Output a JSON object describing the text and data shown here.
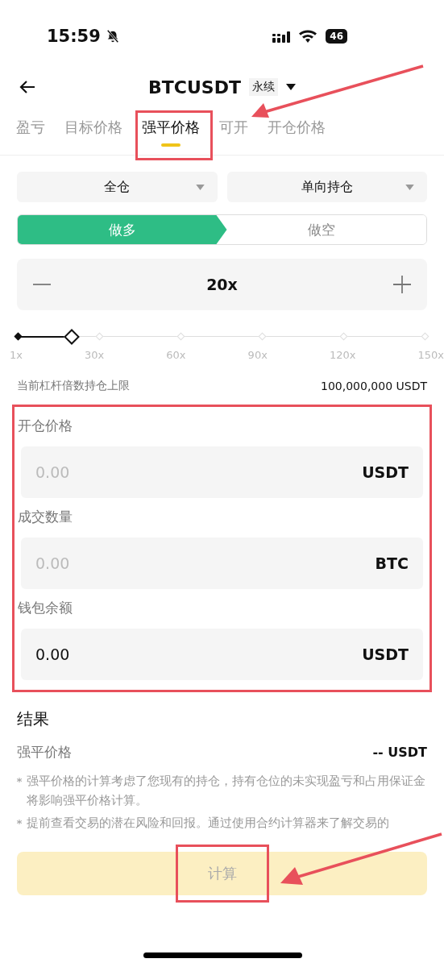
{
  "status_bar": {
    "time": "15:59",
    "battery": "46"
  },
  "header": {
    "title": "BTCUSDT",
    "badge": "永续"
  },
  "tabs": [
    {
      "label": "盈亏",
      "selected": false
    },
    {
      "label": "目标价格",
      "selected": false
    },
    {
      "label": "强平价格",
      "selected": true
    },
    {
      "label": "可开",
      "selected": false
    },
    {
      "label": "开仓价格",
      "selected": false
    }
  ],
  "selectors": [
    {
      "value": "全仓"
    },
    {
      "value": "单向持仓"
    }
  ],
  "sides": [
    {
      "label": "做多",
      "selected": true
    },
    {
      "label": "做空",
      "selected": false
    }
  ],
  "leverage": {
    "value": "20x",
    "level": 0.13,
    "ticks": [
      "1x",
      "30x",
      "60x",
      "90x",
      "120x",
      "150x"
    ]
  },
  "limit": {
    "label": "当前杠杆倍数持仓上限",
    "value": "100,000,000 USDT"
  },
  "fields": [
    {
      "label": "开仓价格",
      "placeholder": "0.00",
      "unit": "USDT"
    },
    {
      "label": "成交数量",
      "placeholder": "0.00",
      "unit": "BTC"
    },
    {
      "label": "钱包余额",
      "value": "0.00",
      "unit": "USDT"
    }
  ],
  "result": {
    "title": "结果",
    "rows": [
      {
        "label": "强平价格",
        "value": "-- USDT"
      }
    ]
  },
  "notes": [
    "强平价格的计算考虑了您现有的持仓，持有仓位的未实现盈亏和占用保证金将影响强平价格计算。",
    "提前查看交易的潜在风险和回报。通过使用合约计算器来了解交易的"
  ],
  "button": {
    "label": "计算",
    "disabled": true
  }
}
